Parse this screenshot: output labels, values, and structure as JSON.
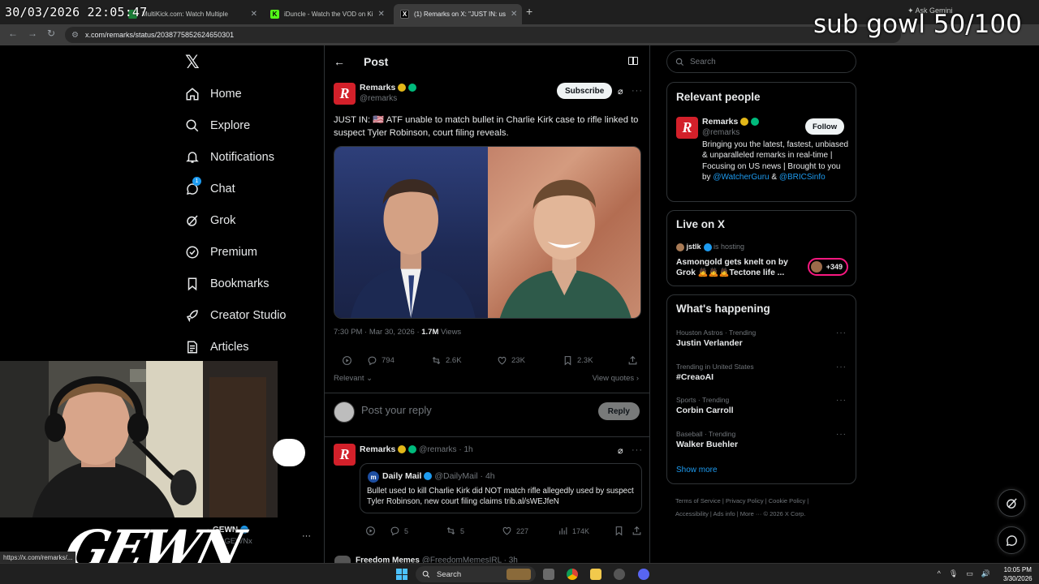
{
  "overlay": {
    "clock": "30/03/2026 22:05:47",
    "goal": "sub gowl 50/100"
  },
  "browser": {
    "tabs": [
      {
        "label": "MultiKick.com: Watch Multiple",
        "active": false
      },
      {
        "label": "iDuncle - Watch the VOD on Ki",
        "active": false
      },
      {
        "label": "(1) Remarks on X: \"JUST IN: us",
        "active": true
      }
    ],
    "gemini": "Ask Gemini",
    "url": "x.com/remarks/status/2038775852624650301"
  },
  "nav": {
    "items": [
      {
        "label": "Home"
      },
      {
        "label": "Explore"
      },
      {
        "label": "Notifications"
      },
      {
        "label": "Chat"
      },
      {
        "label": "Grok"
      },
      {
        "label": "Premium"
      },
      {
        "label": "Bookmarks"
      },
      {
        "label": "Creator Studio"
      },
      {
        "label": "Articles"
      }
    ],
    "chat_badge": "1"
  },
  "post": {
    "header_title": "Post",
    "author_name": "Remarks",
    "author_handle": "@remarks",
    "subscribe_label": "Subscribe",
    "text": "JUST IN: 🇺🇸 ATF unable to match bullet in Charlie Kirk case to rifle linked to suspect Tyler Robinson, court filing reveals.",
    "time": "7:30 PM · Mar 30, 2026 · ",
    "views_count": "1.7M",
    "views_label": " Views",
    "stats": {
      "replies": "794",
      "reposts": "2.6K",
      "likes": "23K",
      "bookmarks": "2.3K"
    },
    "relevant_label": "Relevant",
    "view_quotes_label": "View quotes",
    "reply_placeholder": "Post your reply",
    "reply_button": "Reply"
  },
  "reply": {
    "name": "Remarks",
    "handle_time": "@remarks · 1h",
    "quote_name": "Daily Mail",
    "quote_handle_time": "@DailyMail · 4h",
    "quote_text": "Bullet used to kill Charlie Kirk did NOT match rifle allegedly used by suspect Tyler Robinson, new court filing claims trib.al/sWEJfeN",
    "stats": {
      "replies": "5",
      "reposts": "5",
      "likes": "227",
      "views": "174K"
    }
  },
  "next_post": {
    "name": "Freedom Memes",
    "handle_time": "@FreedomMemesIRL · 3h"
  },
  "sidebar": {
    "search_placeholder": "Search",
    "relevant_people": {
      "title": "Relevant people",
      "name": "Remarks",
      "handle": "@remarks",
      "follow_label": "Follow",
      "bio_text": "Bringing you the latest, fastest, unbiased & unparalleled remarks in real-time | Focusing on US news | Brought to you by ",
      "bio_link1": "@WatcherGuru",
      "bio_and": " & ",
      "bio_link2": "@BRICSinfo"
    },
    "live": {
      "title": "Live on X",
      "host": "jstlk",
      "host_suffix": " is hosting",
      "line1": "Asmongold gets knelt on by",
      "line2": "Grok 🙇🙇🙇Tectone life ...",
      "count": "+349"
    },
    "happening": {
      "title": "What's happening",
      "trends": [
        {
          "meta": "Houston Astros · Trending",
          "name": "Justin Verlander"
        },
        {
          "meta": "Trending in United States",
          "name": "#CreaoAI"
        },
        {
          "meta": "Sports · Trending",
          "name": "Corbin Carroll"
        },
        {
          "meta": "Baseball · Trending",
          "name": "Walker Buehler"
        }
      ],
      "show_more": "Show more"
    },
    "footer": {
      "line1": "Terms of Service  |  Privacy Policy  |  Cookie Policy  |",
      "line2": "Accessibility  |  Ads info  |  More ···  © 2026 X Corp."
    }
  },
  "account": {
    "name": "GEWN",
    "handle": "@xGEWNx",
    "logo_text": "GEWN"
  },
  "statusbar": "https://x.com/remarks/...",
  "taskbar": {
    "search": "Search",
    "time": "10:05 PM",
    "date": "3/30/2026"
  }
}
